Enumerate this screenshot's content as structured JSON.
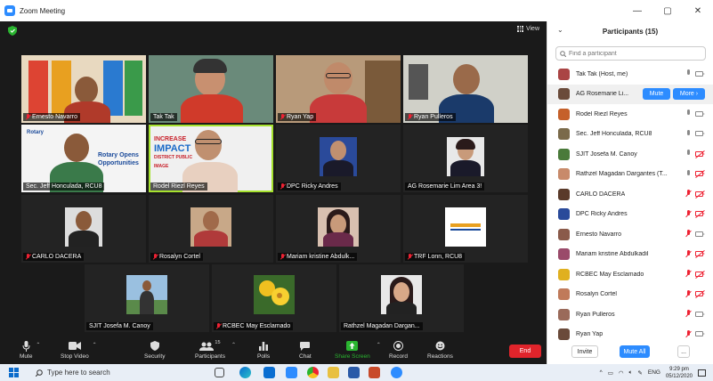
{
  "window": {
    "title": "Zoom Meeting",
    "controls": [
      "—",
      "▢",
      "✕"
    ]
  },
  "video": {
    "view_label": "View",
    "tiles": [
      {
        "name": "Ernesto Navarro",
        "muted": true
      },
      {
        "name": "Tak Tak",
        "muted": false
      },
      {
        "name": "Ryan Yap",
        "muted": true
      },
      {
        "name": "Ryan Pulleros",
        "muted": true
      },
      {
        "name": "Sec. Jeff Honculada, RCU8",
        "muted": false
      },
      {
        "name": "Rodel Riezl Reyes",
        "muted": false,
        "speaking": true
      },
      {
        "name": "DPC Ricky Andres",
        "muted": true
      },
      {
        "name": "AG Rosemarie Lim Area 3!",
        "muted": false
      },
      {
        "name": "CARLO DACERA",
        "muted": true
      },
      {
        "name": "Rosalyn Cortel",
        "muted": true
      },
      {
        "name": "Mariam kristine Abdulk...",
        "muted": true
      },
      {
        "name": "TRF Lonn, RCU8",
        "muted": true
      },
      {
        "name": "SJIT Josefa M. Canoy",
        "muted": false
      },
      {
        "name": "RCBEC May Esclamado",
        "muted": true
      },
      {
        "name": "Rathzel Magadan Dargan...",
        "muted": false
      }
    ],
    "shared_slide": {
      "line1": "INCREASE",
      "line2": "IMPACT",
      "line3": "DISTRICT PUBLIC",
      "line4": "IMAGE"
    },
    "rotary_sign": {
      "club": "Rotary",
      "text1": "Rotary Opens",
      "text2": "Opportunities"
    }
  },
  "toolbar": {
    "mute": "Mute",
    "stop_video": "Stop Video",
    "security": "Security",
    "participants": "Participants",
    "participants_count": "15",
    "polls": "Polls",
    "chat": "Chat",
    "share": "Share Screen",
    "record": "Record",
    "reactions": "Reactions",
    "end": "End"
  },
  "panel": {
    "title": "Participants (15)",
    "search_placeholder": "Find a participant",
    "participants": [
      {
        "name": "Tak Tak (Host, me)",
        "mic": "on",
        "cam": "on",
        "avatar": "#a44"
      },
      {
        "name": "AG Rosemarie Li...",
        "mic": "hover",
        "cam": "hover",
        "avatar": "#6a4a3a"
      },
      {
        "name": "Rodel Riezl Reyes",
        "mic": "on",
        "cam": "on",
        "avatar": "#c5602a"
      },
      {
        "name": "Sec. Jeff Honculada, RCU8",
        "mic": "on",
        "cam": "on",
        "avatar": "#7a6a4a"
      },
      {
        "name": "SJIT Josefa M. Canoy",
        "mic": "on",
        "cam": "off",
        "avatar": "#4a7a3a"
      },
      {
        "name": "Rathzel Magadan Dargantes (T...",
        "mic": "on",
        "cam": "off",
        "avatar": "#c88a6a"
      },
      {
        "name": "CARLO DACERA",
        "mic": "off",
        "cam": "off",
        "avatar": "#5a3a2a"
      },
      {
        "name": "DPC Ricky Andres",
        "mic": "off",
        "cam": "off",
        "avatar": "#2a4a9a"
      },
      {
        "name": "Ernesto Navarro",
        "mic": "off",
        "cam": "on",
        "avatar": "#8a5a4a"
      },
      {
        "name": "Mariam kristine Abdulkadil",
        "mic": "off",
        "cam": "off",
        "avatar": "#9a4a6a"
      },
      {
        "name": "RCBEC May Esclamado",
        "mic": "off",
        "cam": "off",
        "avatar": "#e0b020"
      },
      {
        "name": "Rosalyn Cortel",
        "mic": "off",
        "cam": "off",
        "avatar": "#c07a5a"
      },
      {
        "name": "Ryan Pulleros",
        "mic": "off",
        "cam": "on",
        "avatar": "#9a6a5a"
      },
      {
        "name": "Ryan Yap",
        "mic": "off",
        "cam": "on",
        "avatar": "#6a4a3a"
      }
    ],
    "mute_label": "Mute",
    "more_label": "More ›",
    "invite": "Invite",
    "mute_all": "Mute All",
    "more_dots": "..."
  },
  "taskbar": {
    "search_placeholder": "Type here to search",
    "lang": "ENG",
    "time": "9:29 pm",
    "date": "05/12/2020"
  }
}
